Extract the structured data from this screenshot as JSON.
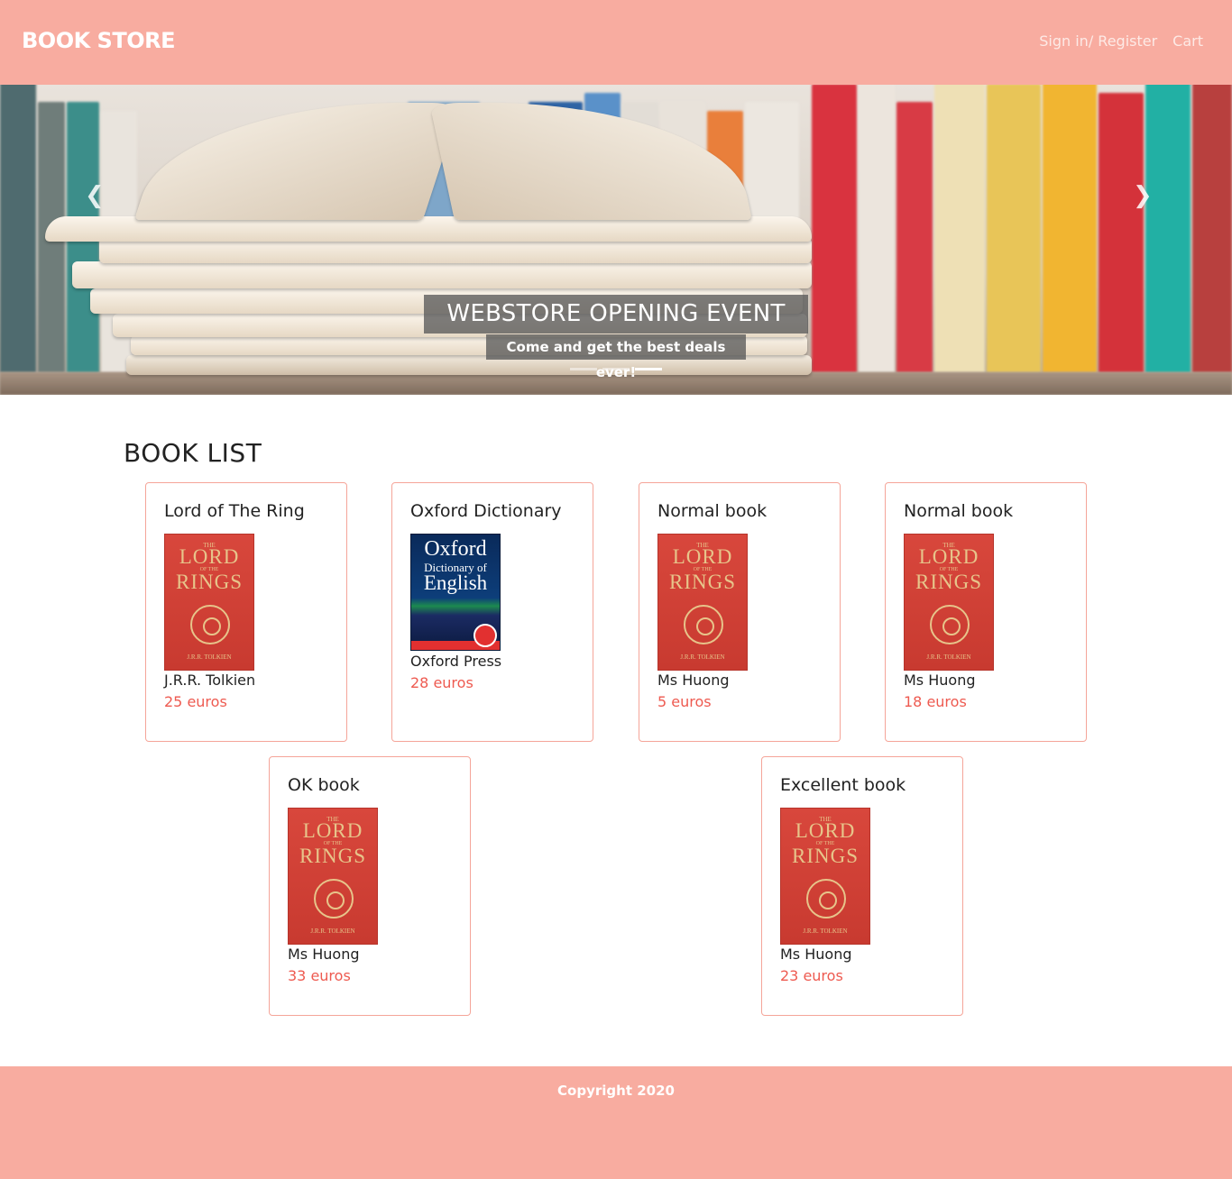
{
  "header": {
    "brand": "BOOK STORE",
    "nav": [
      {
        "label": "Sign in/ Register"
      },
      {
        "label": "Cart"
      }
    ]
  },
  "carousel": {
    "title": "WEBSTORE OPENING EVENT",
    "subtitle": "Come and get the best deals ever!",
    "prev_icon": "chevron-left-icon",
    "next_icon": "chevron-right-icon",
    "slide_count": 3,
    "active_slide": 3
  },
  "book_list": {
    "heading": "BOOK LIST",
    "books": [
      {
        "title": "Lord of The Ring",
        "author": "J.R.R. Tolkien",
        "price": "25 euros",
        "cover": "lotr"
      },
      {
        "title": "Oxford Dictionary",
        "author": "Oxford Press",
        "price": "28 euros",
        "cover": "oxford"
      },
      {
        "title": "Normal book",
        "author": "Ms Huong",
        "price": "5 euros",
        "cover": "lotr"
      },
      {
        "title": "Normal book",
        "author": "Ms Huong",
        "price": "18 euros",
        "cover": "lotr"
      },
      {
        "title": "OK book",
        "author": "Ms Huong",
        "price": "33 euros",
        "cover": "lotr"
      },
      {
        "title": "Excellent book",
        "author": "Ms Huong",
        "price": "23 euros",
        "cover": "lotr"
      }
    ],
    "lotr_cover": {
      "the": "THE",
      "lord": "LORD",
      "of_the": "OF THE",
      "rings": "RINGS",
      "author": "J.R.R. TOLKIEN"
    },
    "oxford_cover": {
      "line1": "Oxford",
      "line2": "Dictionary of",
      "line3": "English"
    }
  },
  "footer": {
    "text": "Copyright 2020"
  },
  "colors": {
    "brand": "#f8aca0",
    "price": "#ee5a50",
    "card_border": "#f5a599"
  }
}
